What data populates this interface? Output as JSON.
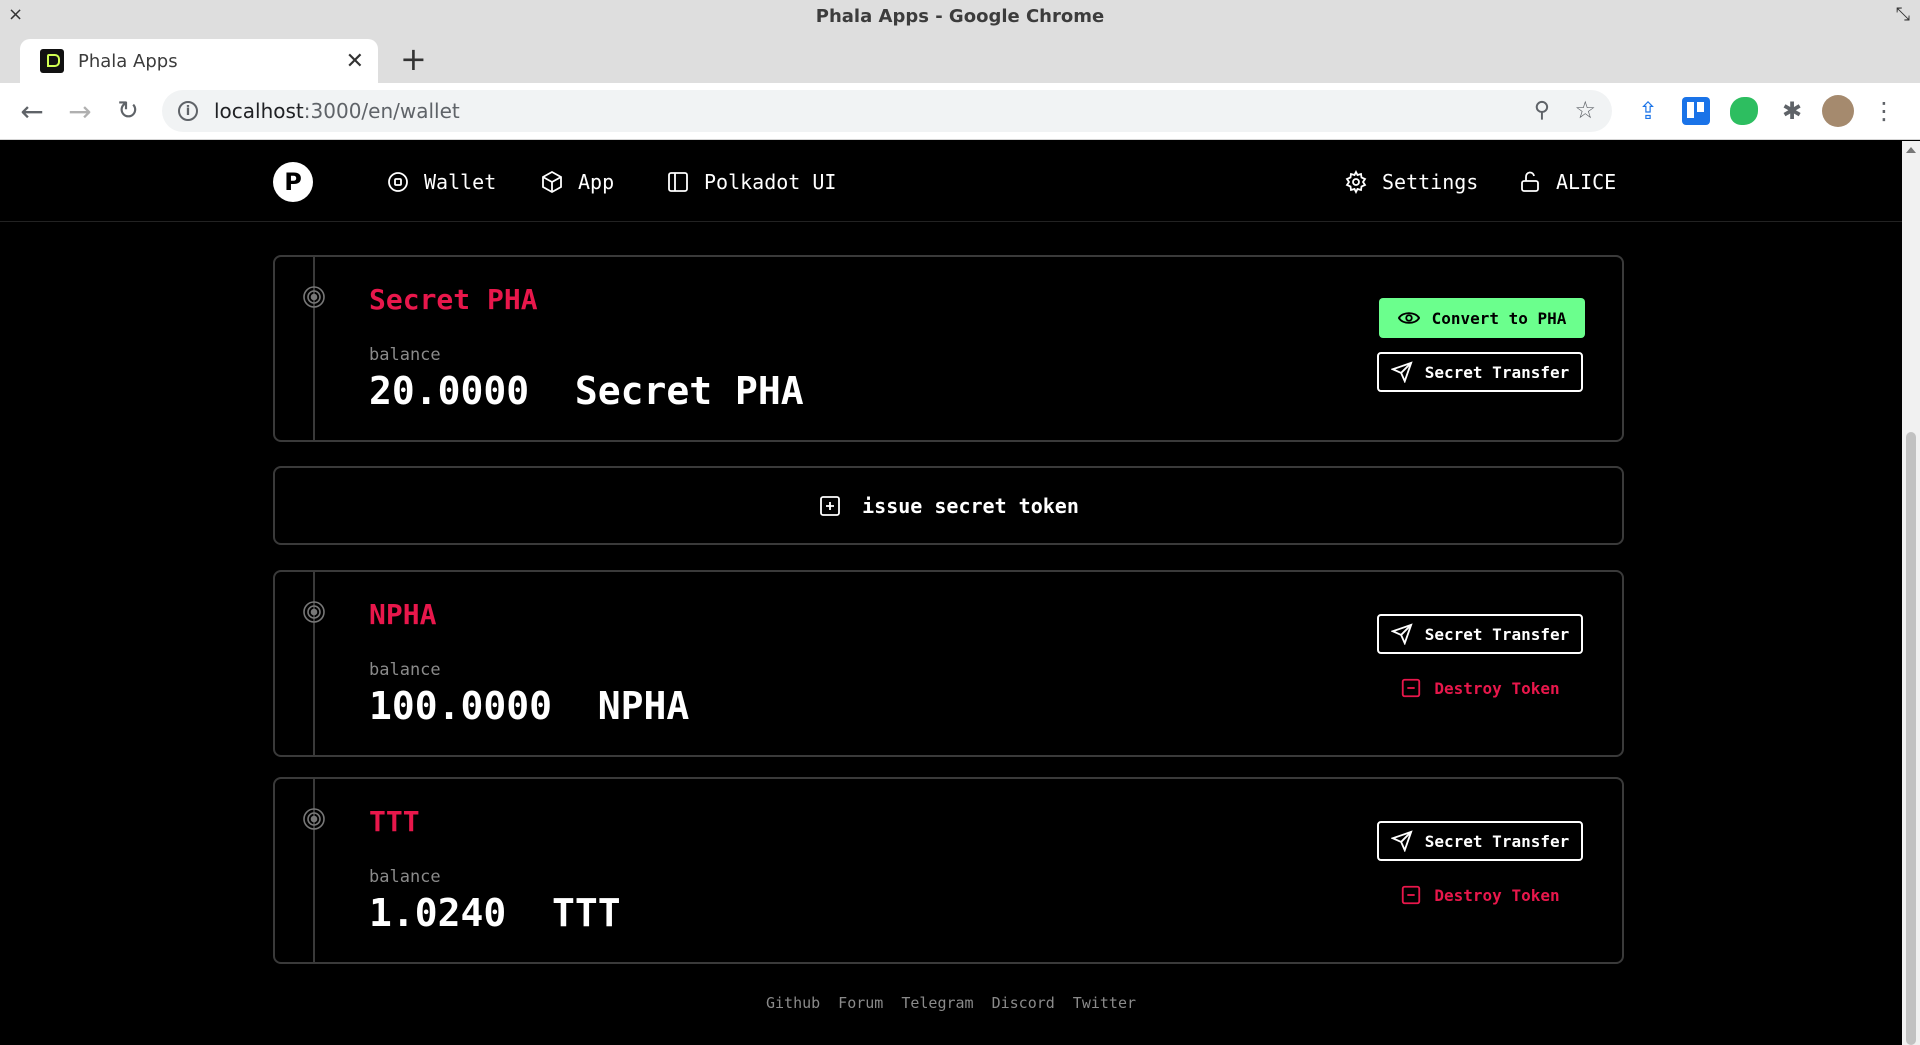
{
  "window": {
    "title": "Phala Apps - Google Chrome"
  },
  "tab": {
    "title": "Phala Apps"
  },
  "address": {
    "host": "localhost",
    "path": ":3000/en/wallet"
  },
  "nav": {
    "logo": "P",
    "items": [
      {
        "label": "Wallet",
        "icon": "wallet-icon"
      },
      {
        "label": "App",
        "icon": "cube-icon"
      },
      {
        "label": "Polkadot UI",
        "icon": "sidebar-icon"
      }
    ],
    "settings": "Settings",
    "account": "ALICE"
  },
  "tokens": [
    {
      "name": "Secret PHA",
      "balance_label": "balance",
      "balance": "20.0000  Secret PHA",
      "primary_action": "Convert to PHA",
      "transfer": "Secret Transfer"
    },
    {
      "name": "NPHA",
      "balance_label": "balance",
      "balance": "100.0000  NPHA",
      "transfer": "Secret Transfer",
      "destroy": "Destroy Token"
    },
    {
      "name": "TTT",
      "balance_label": "balance",
      "balance": "1.0240  TTT",
      "transfer": "Secret Transfer",
      "destroy": "Destroy Token"
    }
  ],
  "issue": {
    "label": "issue secret token"
  },
  "footer": {
    "links": [
      "Github",
      "Forum",
      "Telegram",
      "Discord",
      "Twitter"
    ]
  },
  "colors": {
    "accent": "#e8174b",
    "primary": "#6bff8d",
    "background": "#000000"
  }
}
